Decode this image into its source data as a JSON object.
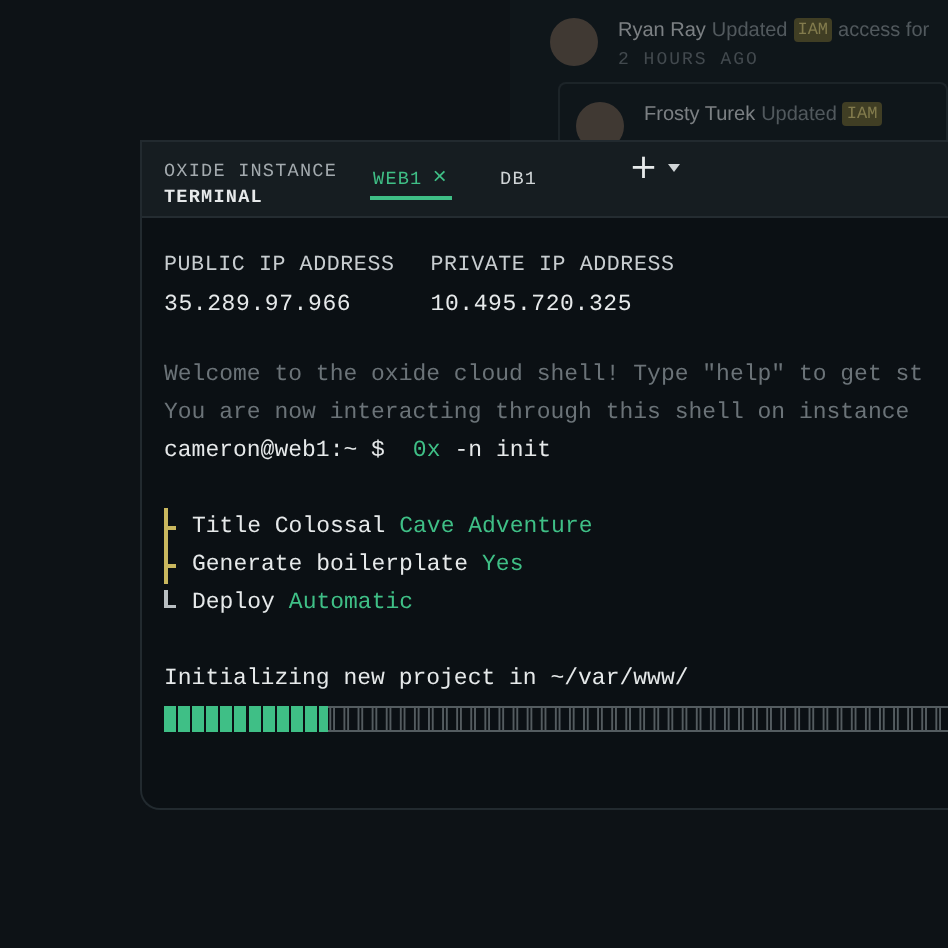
{
  "activity_feed": [
    {
      "name": "Ryan Ray",
      "action": "Updated",
      "tag": "IAM",
      "detail": "access for",
      "time": "2 HOURS AGO"
    },
    {
      "name": "Frosty Turek",
      "action": "Updated",
      "tag": "IAM"
    }
  ],
  "terminal": {
    "title": "OXIDE INSTANCE",
    "subtitle": "TERMINAL",
    "tabs": [
      {
        "label": "WEB1",
        "close": "×",
        "selected": true
      },
      {
        "label": "DB1",
        "selected": false
      }
    ],
    "add_button": "+",
    "ip": [
      {
        "label": "PUBLIC IP ADDRESS",
        "value": "35.289.97.966"
      },
      {
        "label": "PRIVATE IP ADDRESS",
        "value": "10.495.720.325"
      }
    ],
    "messages": [
      "Welcome to the oxide cloud shell! Type \"help\" to get st",
      "You are now interacting through this shell on instance"
    ],
    "prompt": {
      "user": "cameron@web1:~ $",
      "command": "0x",
      "args": "-n init"
    },
    "steps": [
      {
        "kind": "branch",
        "label": "Title Colossal",
        "value": "Cave Adventure",
        "color": "#c9b75e"
      },
      {
        "kind": "branch",
        "label": "Generate boilerplate",
        "value": "Yes",
        "color": "#c9b75e"
      },
      {
        "kind": "last",
        "label": "Deploy",
        "value": "Automatic",
        "color": "#b9bfc2"
      }
    ],
    "status": "Initializing new project in ~/var/www/",
    "progress": {
      "level": 0.21
    }
  }
}
